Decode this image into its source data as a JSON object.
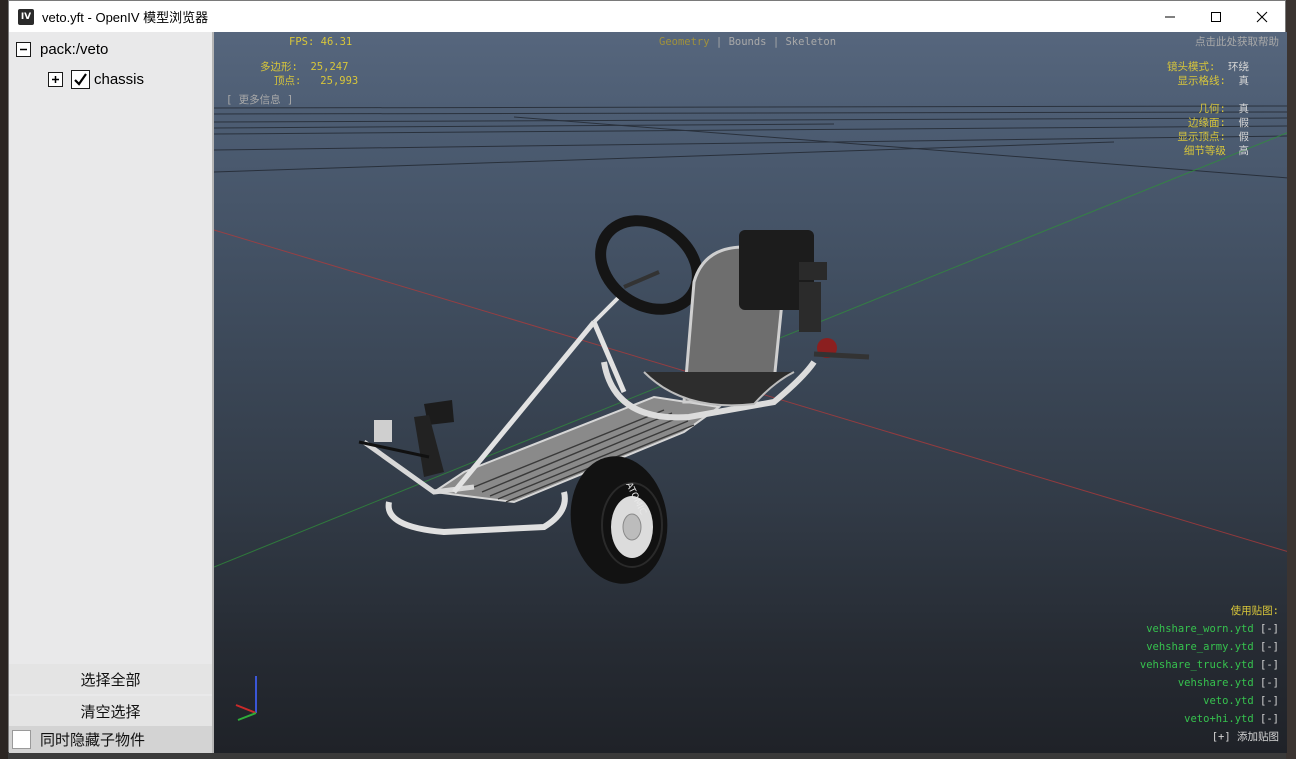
{
  "window": {
    "icon_text": "IV",
    "title": "veto.yft - OpenIV 模型浏览器"
  },
  "tree": {
    "root_label": "pack:/veto",
    "child_label": "chassis"
  },
  "sidebar": {
    "select_all": "选择全部",
    "clear_selection": "清空选择",
    "hide_children": "同时隐藏子物件"
  },
  "hud": {
    "fps_label": "FPS:",
    "fps_value": "46.31",
    "polygons_label": "多边形:",
    "polygons_value": "25,247",
    "vertices_label": "顶点:",
    "vertices_value": "25,993",
    "more_info": "[ 更多信息 ]",
    "tabs": [
      "Geometry",
      "Bounds",
      "Skeleton"
    ],
    "tab_separator": "|",
    "help": "点击此处获取帮助",
    "settings": [
      {
        "label": "镜头模式:",
        "value": "环绕"
      },
      {
        "label": "显示格线:",
        "value": "真"
      },
      {
        "label": "几何:",
        "value": "真"
      },
      {
        "label": "边缘面:",
        "value": "假"
      },
      {
        "label": "显示顶点:",
        "value": "假"
      },
      {
        "label": "细节等级",
        "value": "高"
      }
    ],
    "textures_title": "使用贴图:",
    "textures": [
      {
        "name": "vehshare_worn.ytd",
        "action": "[-]"
      },
      {
        "name": "vehshare_army.ytd",
        "action": "[-]"
      },
      {
        "name": "vehshare_truck.ytd",
        "action": "[-]"
      },
      {
        "name": "vehshare.ytd",
        "action": "[-]"
      },
      {
        "name": "veto.ytd",
        "action": "[-]"
      },
      {
        "name": "veto+hi.ytd",
        "action": "[-]"
      }
    ],
    "add_texture_icon": "[+]",
    "add_texture_label": "添加贴图"
  },
  "tire_text": "ATOMIC",
  "colors": {
    "hud_yellow": "#d8c63a",
    "hud_green": "#36c24e",
    "grid_red": "#b33a3a",
    "grid_green": "#2f8f3a"
  }
}
